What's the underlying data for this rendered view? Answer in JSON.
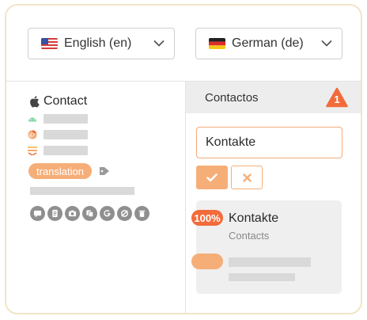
{
  "source_language": {
    "label": "English (en)",
    "flag": "us-flag-icon"
  },
  "target_language": {
    "label": "German (de)",
    "flag": "de-flag-icon"
  },
  "source": {
    "platform_icon": "apple-icon",
    "title": "Contact",
    "meta_icons": [
      "android-icon",
      "chrome-icon",
      "stack-icon"
    ],
    "tag": "translation",
    "tools": [
      "comment-icon",
      "document-icon",
      "camera-icon",
      "copy-icon",
      "google-icon",
      "eye-off-icon",
      "trash-icon"
    ]
  },
  "target": {
    "header": "Contactos",
    "warning_count": "1",
    "input_value": "Kontakte"
  },
  "suggestion": {
    "match": "100%",
    "text": "Kontakte",
    "source_text": "Contacts"
  },
  "colors": {
    "accent": "#f6ae78",
    "badge": "#f26b3a",
    "header_bg": "#ededed"
  }
}
